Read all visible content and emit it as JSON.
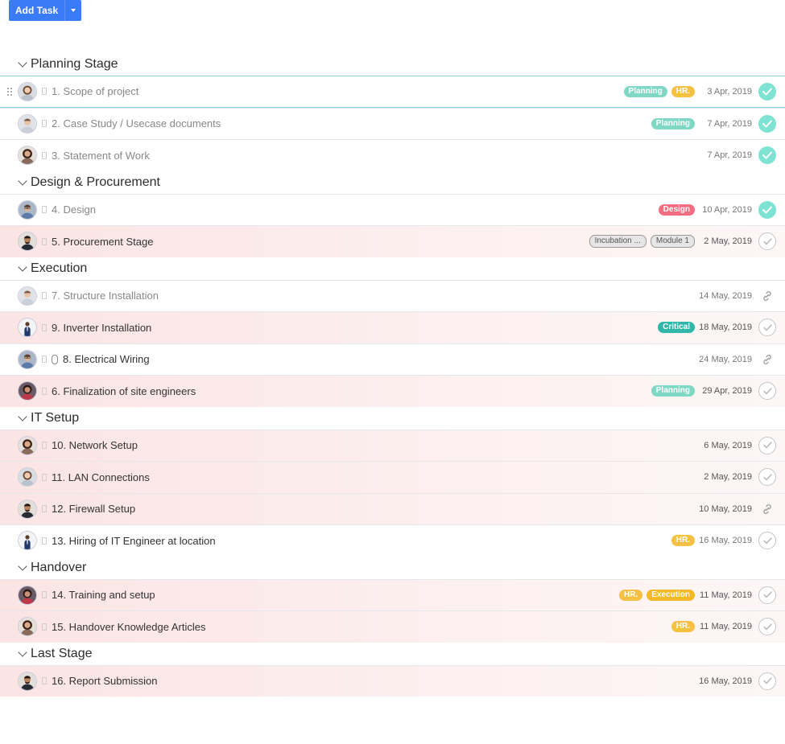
{
  "toolbar": {
    "add_task_label": "Add Task"
  },
  "colors": {
    "accent": "#3a7bf7",
    "done": "#7ee3d2",
    "Planning": "#7fd8c4",
    "HR": "#f5c044",
    "Design": "#f26d7f",
    "Critical": "#2fb8aa",
    "Execution": "#f5b827",
    "outline": "#e6e6e6"
  },
  "groups": [
    {
      "title": "Planning Stage",
      "tasks": [
        {
          "name": "1. Scope of project",
          "tags": [
            "Planning",
            "HR."
          ],
          "date": "3 Apr, 2019",
          "status": "done",
          "avatar": "woman-light",
          "selected": true,
          "overdue": false,
          "muted": true
        },
        {
          "name": "2. Case Study / Usecase documents",
          "tags": [
            "Planning"
          ],
          "date": "7 Apr, 2019",
          "status": "done",
          "avatar": "man-light",
          "overdue": false,
          "muted": true
        },
        {
          "name": "3. Statement of Work",
          "tags": [],
          "date": "7 Apr, 2019",
          "status": "done",
          "avatar": "woman-dark",
          "overdue": false,
          "muted": true
        }
      ]
    },
    {
      "title": "Design & Procurement",
      "tasks": [
        {
          "name": "4. Design",
          "tags": [
            "Design"
          ],
          "date": "10 Apr, 2019",
          "status": "done",
          "avatar": "man-glasses",
          "overdue": false,
          "muted": true
        },
        {
          "name": "5. Procurement Stage",
          "tags": [
            "Incubation ...",
            "Module 1"
          ],
          "date": "2 May, 2019",
          "status": "todo",
          "avatar": "man-dark",
          "overdue": true,
          "muted": false
        }
      ]
    },
    {
      "title": "Execution",
      "tasks": [
        {
          "name": "7. Structure Installation",
          "tags": [],
          "date": "14 May, 2019",
          "status": "link",
          "avatar": "man-light",
          "overdue": false,
          "muted": true
        },
        {
          "name": "9. Inverter Installation",
          "tags": [
            "Critical"
          ],
          "date": "18 May, 2019",
          "status": "todo",
          "avatar": "man-suit",
          "overdue": true,
          "muted": false
        },
        {
          "name": "8. Electrical Wiring",
          "tags": [],
          "date": "24 May, 2019",
          "status": "link",
          "avatar": "man-glasses",
          "overdue": false,
          "muted": false,
          "clip": true
        },
        {
          "name": "6. Finalization of site engineers",
          "tags": [
            "Planning"
          ],
          "date": "29 Apr, 2019",
          "status": "todo",
          "avatar": "woman-red",
          "overdue": true,
          "muted": false
        }
      ]
    },
    {
      "title": "IT Setup",
      "tasks": [
        {
          "name": "10. Network Setup",
          "tags": [],
          "date": "6 May, 2019",
          "status": "todo",
          "avatar": "woman-dark",
          "overdue": true,
          "muted": false
        },
        {
          "name": "11. LAN Connections",
          "tags": [],
          "date": "2 May, 2019",
          "status": "todo",
          "avatar": "woman-light",
          "overdue": true,
          "muted": false
        },
        {
          "name": "12. Firewall Setup",
          "tags": [],
          "date": "10 May, 2019",
          "status": "link",
          "avatar": "man-dark",
          "overdue": true,
          "muted": false
        },
        {
          "name": "13. Hiring of IT Engineer at location",
          "tags": [
            "HR."
          ],
          "date": "16 May, 2019",
          "status": "todo",
          "avatar": "man-suit",
          "overdue": false,
          "muted": false
        }
      ]
    },
    {
      "title": "Handover",
      "tasks": [
        {
          "name": "14. Training and setup",
          "tags": [
            "HR.",
            "Execution"
          ],
          "date": "11 May, 2019",
          "status": "todo",
          "avatar": "woman-red",
          "overdue": true,
          "muted": false
        },
        {
          "name": "15. Handover Knowledge Articles",
          "tags": [
            "HR."
          ],
          "date": "11 May, 2019",
          "status": "todo",
          "avatar": "woman-dark",
          "overdue": true,
          "muted": false
        }
      ]
    },
    {
      "title": "Last Stage",
      "tasks": [
        {
          "name": "16. Report Submission",
          "tags": [],
          "date": "16 May, 2019",
          "status": "todo",
          "avatar": "man-dark",
          "overdue": true,
          "muted": false
        }
      ]
    }
  ]
}
